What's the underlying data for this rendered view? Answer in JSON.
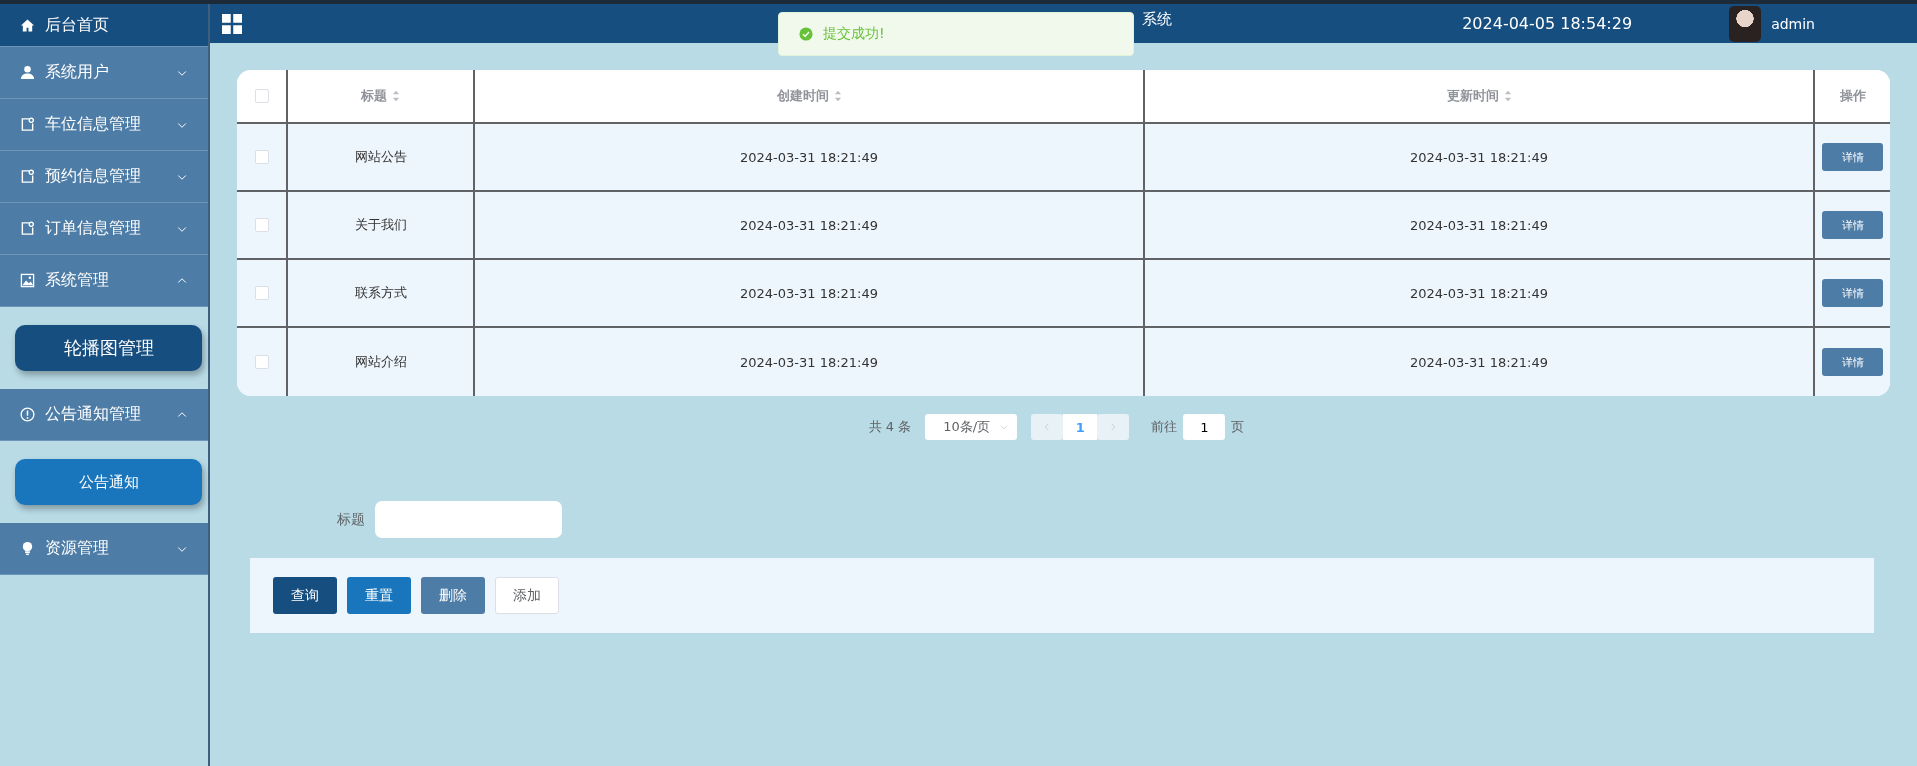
{
  "header": {
    "title": "系统",
    "datetime": "2024-04-05 18:54:29",
    "user": "admin"
  },
  "toast": {
    "kind": "success",
    "message": "提交成功!"
  },
  "sidebar": {
    "items": [
      {
        "label": "后台首页",
        "kind": "link",
        "selected": true
      },
      {
        "label": "系统用户",
        "kind": "menu",
        "expanded": false
      },
      {
        "label": "车位信息管理",
        "kind": "menu",
        "expanded": false
      },
      {
        "label": "预约信息管理",
        "kind": "menu",
        "expanded": false
      },
      {
        "label": "订单信息管理",
        "kind": "menu",
        "expanded": false
      },
      {
        "label": "系统管理",
        "kind": "menu",
        "expanded": true,
        "children": [
          {
            "label": "轮播图管理",
            "selected": true
          }
        ]
      },
      {
        "label": "公告通知管理",
        "kind": "menu",
        "expanded": true,
        "children": [
          {
            "label": "公告通知",
            "selected": false
          }
        ]
      },
      {
        "label": "资源管理",
        "kind": "menu",
        "expanded": false
      }
    ]
  },
  "table": {
    "all_checked": false,
    "columns": [
      {
        "label": "标题",
        "sortable": true
      },
      {
        "label": "创建时间",
        "sortable": true
      },
      {
        "label": "更新时间",
        "sortable": true
      },
      {
        "label": "操作",
        "sortable": false
      }
    ],
    "rows": [
      {
        "checked": false,
        "title": "网站公告",
        "created": "2024-03-31 18:21:49",
        "updated": "2024-03-31 18:21:49",
        "action": "详情"
      },
      {
        "checked": false,
        "title": "关于我们",
        "created": "2024-03-31 18:21:49",
        "updated": "2024-03-31 18:21:49",
        "action": "详情"
      },
      {
        "checked": false,
        "title": "联系方式",
        "created": "2024-03-31 18:21:49",
        "updated": "2024-03-31 18:21:49",
        "action": "详情"
      },
      {
        "checked": false,
        "title": "网站介绍",
        "created": "2024-03-31 18:21:49",
        "updated": "2024-03-31 18:21:49",
        "action": "详情"
      }
    ]
  },
  "pagination": {
    "total": "共 4 条",
    "page_size": "10条/页",
    "pages": [
      {
        "label": "1",
        "selected": true
      }
    ],
    "goto_label": "前往",
    "goto_value": "1",
    "goto_suffix": "页"
  },
  "search": {
    "label": "标题"
  },
  "buttons": [
    {
      "label": "查询",
      "kind": "query"
    },
    {
      "label": "重置",
      "kind": "reset"
    },
    {
      "label": "删除",
      "kind": "delete"
    },
    {
      "label": "添加",
      "kind": "add"
    }
  ]
}
